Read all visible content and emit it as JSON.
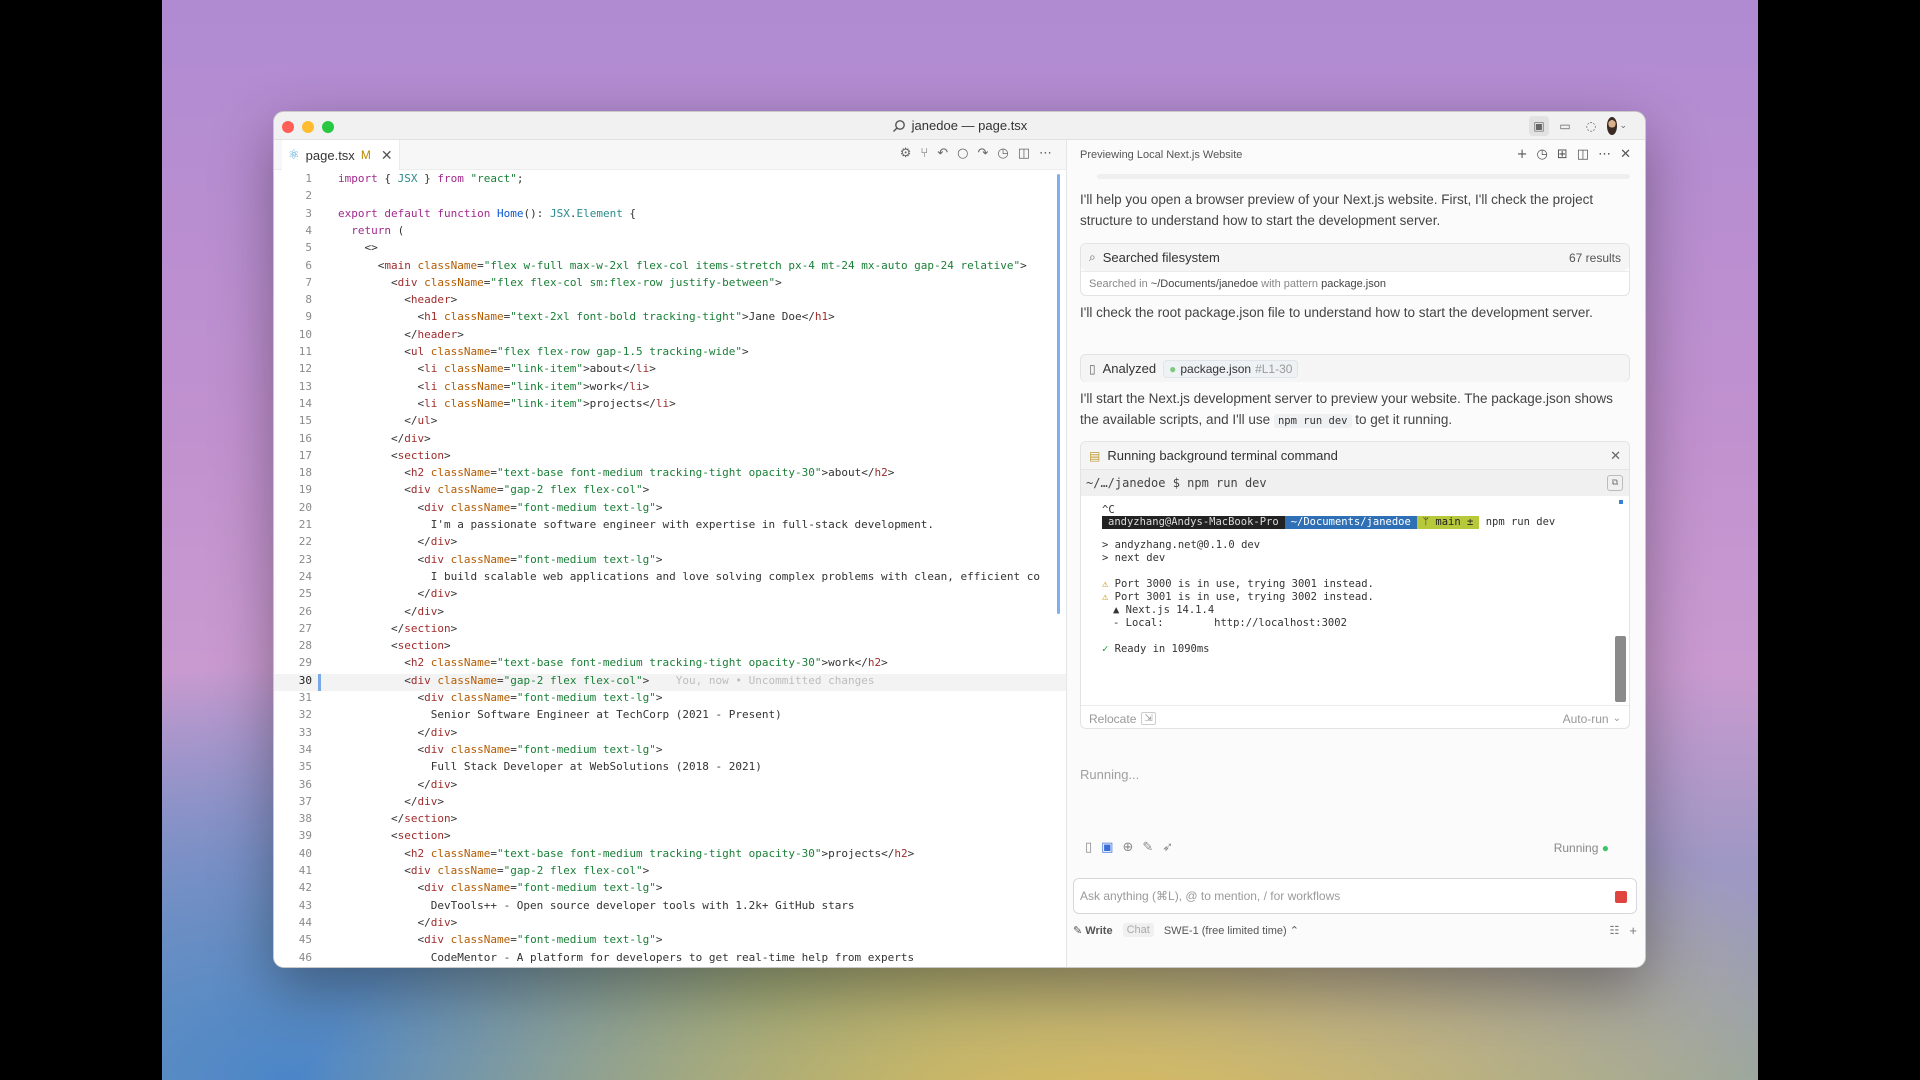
{
  "window": {
    "title": "janedoe — page.tsx",
    "traffic_lights": {
      "close": "#ff5f57",
      "minimize": "#febc2e",
      "zoom": "#28c840"
    }
  },
  "editor": {
    "tab": {
      "filename": "page.tsx",
      "status": "M"
    },
    "current_line": 30,
    "blame_text": "You, now • Uncommitted changes",
    "lines": [
      [
        [
          "kw",
          "import "
        ],
        [
          "pl",
          "{ "
        ],
        [
          "typ",
          "JSX"
        ],
        [
          "pl",
          " } "
        ],
        [
          "kw",
          "from "
        ],
        [
          "str",
          "\"react\""
        ],
        [
          "pl",
          ";"
        ]
      ],
      [],
      [
        [
          "kw",
          "export default function "
        ],
        [
          "kb",
          "Home"
        ],
        [
          "pl",
          "(): "
        ],
        [
          "typ",
          "JSX"
        ],
        [
          "pl",
          "."
        ],
        [
          "typ",
          "Element"
        ],
        [
          "pl",
          " {"
        ]
      ],
      [
        [
          "pl",
          "  "
        ],
        [
          "kw",
          "return"
        ],
        [
          "pl",
          " ("
        ]
      ],
      [
        [
          "pl",
          "    <>"
        ]
      ],
      [
        [
          "pl",
          "      <"
        ],
        [
          "tag",
          "main "
        ],
        [
          "at",
          "className"
        ],
        [
          "pl",
          "="
        ],
        [
          "str",
          "\"flex w-full max-w-2xl flex-col items-stretch px-4 mt-24 mx-auto gap-24 relative\""
        ],
        [
          "pl",
          ">"
        ]
      ],
      [
        [
          "pl",
          "        <"
        ],
        [
          "tag",
          "div "
        ],
        [
          "at",
          "className"
        ],
        [
          "pl",
          "="
        ],
        [
          "str",
          "\"flex flex-col sm:flex-row justify-between\""
        ],
        [
          "pl",
          ">"
        ]
      ],
      [
        [
          "pl",
          "          <"
        ],
        [
          "tag",
          "header"
        ],
        [
          "pl",
          ">"
        ]
      ],
      [
        [
          "pl",
          "            <"
        ],
        [
          "tag",
          "h1 "
        ],
        [
          "at",
          "className"
        ],
        [
          "pl",
          "="
        ],
        [
          "str",
          "\"text-2xl font-bold tracking-tight\""
        ],
        [
          "pl",
          ">Jane Doe</"
        ],
        [
          "tag",
          "h1"
        ],
        [
          "pl",
          ">"
        ]
      ],
      [
        [
          "pl",
          "          </"
        ],
        [
          "tag",
          "header"
        ],
        [
          "pl",
          ">"
        ]
      ],
      [
        [
          "pl",
          "          <"
        ],
        [
          "tag",
          "ul "
        ],
        [
          "at",
          "className"
        ],
        [
          "pl",
          "="
        ],
        [
          "str",
          "\"flex flex-row gap-1.5 tracking-wide\""
        ],
        [
          "pl",
          ">"
        ]
      ],
      [
        [
          "pl",
          "            <"
        ],
        [
          "tag",
          "li "
        ],
        [
          "at",
          "className"
        ],
        [
          "pl",
          "="
        ],
        [
          "str",
          "\"link-item\""
        ],
        [
          "pl",
          ">about</"
        ],
        [
          "tag",
          "li"
        ],
        [
          "pl",
          ">"
        ]
      ],
      [
        [
          "pl",
          "            <"
        ],
        [
          "tag",
          "li "
        ],
        [
          "at",
          "className"
        ],
        [
          "pl",
          "="
        ],
        [
          "str",
          "\"link-item\""
        ],
        [
          "pl",
          ">work</"
        ],
        [
          "tag",
          "li"
        ],
        [
          "pl",
          ">"
        ]
      ],
      [
        [
          "pl",
          "            <"
        ],
        [
          "tag",
          "li "
        ],
        [
          "at",
          "className"
        ],
        [
          "pl",
          "="
        ],
        [
          "str",
          "\"link-item\""
        ],
        [
          "pl",
          ">projects</"
        ],
        [
          "tag",
          "li"
        ],
        [
          "pl",
          ">"
        ]
      ],
      [
        [
          "pl",
          "          </"
        ],
        [
          "tag",
          "ul"
        ],
        [
          "pl",
          ">"
        ]
      ],
      [
        [
          "pl",
          "        </"
        ],
        [
          "tag",
          "div"
        ],
        [
          "pl",
          ">"
        ]
      ],
      [
        [
          "pl",
          "        <"
        ],
        [
          "tag",
          "section"
        ],
        [
          "pl",
          ">"
        ]
      ],
      [
        [
          "pl",
          "          <"
        ],
        [
          "tag",
          "h2 "
        ],
        [
          "at",
          "className"
        ],
        [
          "pl",
          "="
        ],
        [
          "str",
          "\"text-base font-medium tracking-tight opacity-30\""
        ],
        [
          "pl",
          ">about</"
        ],
        [
          "tag",
          "h2"
        ],
        [
          "pl",
          ">"
        ]
      ],
      [
        [
          "pl",
          "          <"
        ],
        [
          "tag",
          "div "
        ],
        [
          "at",
          "className"
        ],
        [
          "pl",
          "="
        ],
        [
          "str",
          "\"gap-2 flex flex-col\""
        ],
        [
          "pl",
          ">"
        ]
      ],
      [
        [
          "pl",
          "            <"
        ],
        [
          "tag",
          "div "
        ],
        [
          "at",
          "className"
        ],
        [
          "pl",
          "="
        ],
        [
          "str",
          "\"font-medium text-lg\""
        ],
        [
          "pl",
          ">"
        ]
      ],
      [
        [
          "pl",
          "              I'm a passionate software engineer with expertise in full-stack development."
        ]
      ],
      [
        [
          "pl",
          "            </"
        ],
        [
          "tag",
          "div"
        ],
        [
          "pl",
          ">"
        ]
      ],
      [
        [
          "pl",
          "            <"
        ],
        [
          "tag",
          "div "
        ],
        [
          "at",
          "className"
        ],
        [
          "pl",
          "="
        ],
        [
          "str",
          "\"font-medium text-lg\""
        ],
        [
          "pl",
          ">"
        ]
      ],
      [
        [
          "pl",
          "              I build scalable web applications and love solving complex problems with clean, efficient co"
        ]
      ],
      [
        [
          "pl",
          "            </"
        ],
        [
          "tag",
          "div"
        ],
        [
          "pl",
          ">"
        ]
      ],
      [
        [
          "pl",
          "          </"
        ],
        [
          "tag",
          "div"
        ],
        [
          "pl",
          ">"
        ]
      ],
      [
        [
          "pl",
          "        </"
        ],
        [
          "tag",
          "section"
        ],
        [
          "pl",
          ">"
        ]
      ],
      [
        [
          "pl",
          "        <"
        ],
        [
          "tag",
          "section"
        ],
        [
          "pl",
          ">"
        ]
      ],
      [
        [
          "pl",
          "          <"
        ],
        [
          "tag",
          "h2 "
        ],
        [
          "at",
          "className"
        ],
        [
          "pl",
          "="
        ],
        [
          "str",
          "\"text-base font-medium tracking-tight opacity-30\""
        ],
        [
          "pl",
          ">work</"
        ],
        [
          "tag",
          "h2"
        ],
        [
          "pl",
          ">"
        ]
      ],
      [
        [
          "pl",
          "          <"
        ],
        [
          "tag",
          "div "
        ],
        [
          "at",
          "className"
        ],
        [
          "pl",
          "="
        ],
        [
          "str",
          "\"gap-2 flex flex-col\""
        ],
        [
          "pl",
          ">"
        ]
      ],
      [
        [
          "pl",
          "            <"
        ],
        [
          "tag",
          "div "
        ],
        [
          "at",
          "className"
        ],
        [
          "pl",
          "="
        ],
        [
          "str",
          "\"font-medium text-lg\""
        ],
        [
          "pl",
          ">"
        ]
      ],
      [
        [
          "pl",
          "              Senior Software Engineer at TechCorp (2021 - Present)"
        ]
      ],
      [
        [
          "pl",
          "            </"
        ],
        [
          "tag",
          "div"
        ],
        [
          "pl",
          ">"
        ]
      ],
      [
        [
          "pl",
          "            <"
        ],
        [
          "tag",
          "div "
        ],
        [
          "at",
          "className"
        ],
        [
          "pl",
          "="
        ],
        [
          "str",
          "\"font-medium text-lg\""
        ],
        [
          "pl",
          ">"
        ]
      ],
      [
        [
          "pl",
          "              Full Stack Developer at WebSolutions (2018 - 2021)"
        ]
      ],
      [
        [
          "pl",
          "            </"
        ],
        [
          "tag",
          "div"
        ],
        [
          "pl",
          ">"
        ]
      ],
      [
        [
          "pl",
          "          </"
        ],
        [
          "tag",
          "div"
        ],
        [
          "pl",
          ">"
        ]
      ],
      [
        [
          "pl",
          "        </"
        ],
        [
          "tag",
          "section"
        ],
        [
          "pl",
          ">"
        ]
      ],
      [
        [
          "pl",
          "        <"
        ],
        [
          "tag",
          "section"
        ],
        [
          "pl",
          ">"
        ]
      ],
      [
        [
          "pl",
          "          <"
        ],
        [
          "tag",
          "h2 "
        ],
        [
          "at",
          "className"
        ],
        [
          "pl",
          "="
        ],
        [
          "str",
          "\"text-base font-medium tracking-tight opacity-30\""
        ],
        [
          "pl",
          ">projects</"
        ],
        [
          "tag",
          "h2"
        ],
        [
          "pl",
          ">"
        ]
      ],
      [
        [
          "pl",
          "          <"
        ],
        [
          "tag",
          "div "
        ],
        [
          "at",
          "className"
        ],
        [
          "pl",
          "="
        ],
        [
          "str",
          "\"gap-2 flex flex-col\""
        ],
        [
          "pl",
          ">"
        ]
      ],
      [
        [
          "pl",
          "            <"
        ],
        [
          "tag",
          "div "
        ],
        [
          "at",
          "className"
        ],
        [
          "pl",
          "="
        ],
        [
          "str",
          "\"font-medium text-lg\""
        ],
        [
          "pl",
          ">"
        ]
      ],
      [
        [
          "pl",
          "              DevTools++ - Open source developer tools with 1.2k+ GitHub stars"
        ]
      ],
      [
        [
          "pl",
          "            </"
        ],
        [
          "tag",
          "div"
        ],
        [
          "pl",
          ">"
        ]
      ],
      [
        [
          "pl",
          "            <"
        ],
        [
          "tag",
          "div "
        ],
        [
          "at",
          "className"
        ],
        [
          "pl",
          "="
        ],
        [
          "str",
          "\"font-medium text-lg\""
        ],
        [
          "pl",
          ">"
        ]
      ],
      [
        [
          "pl",
          "              CodeMentor - A platform for developers to get real-time help from experts"
        ]
      ]
    ]
  },
  "panel": {
    "title": "Previewing Local Next.js Website",
    "msg1": "I'll help you open a browser preview of your Next.js website. First, I'll check the project structure to understand how to start the development server.",
    "search": {
      "label": "Searched filesystem",
      "count": "67 results",
      "sub_prefix": "Searched in",
      "path": "~/Documents/janedoe",
      "sub_mid": "with pattern",
      "pattern": "package.json"
    },
    "msg2": "I'll check the root package.json file to understand how to start the development server.",
    "analyzed": {
      "label": "Analyzed",
      "file": "package.json",
      "range": "#L1-30"
    },
    "msg3a": "I'll start the Next.js development server to preview your website. The package.json shows the available scripts, and I'll use",
    "msg3_code": "npm run dev",
    "msg3b": "to get it running.",
    "terminal": {
      "title": "Running background terminal command",
      "command": "~/…/janedoe $ npm run dev",
      "ctrl_c": "^C",
      "prompt_user": "andyzhang@Andys-MacBook-Pro",
      "prompt_dir": "~/Documents/janedoe",
      "prompt_branch": "ᛘ main ±",
      "prompt_cmd": "npm run dev",
      "out1": "> andyzhang.net@0.1.0 dev",
      "out2": "> next dev",
      "warn1": "Port 3000 is in use, trying 3001 instead.",
      "warn2": "Port 3001 is in use, trying 3002 instead.",
      "next": "▲ Next.js 14.1.4",
      "local": "- Local:        http://localhost:3002",
      "ready": "Ready in 1090ms",
      "relocate": "Relocate",
      "autorun": "Auto-run"
    },
    "running_text": "Running...",
    "status": "Running",
    "input_placeholder": "Ask anything (⌘L), @ to mention, / for workflows",
    "mode_write": "Write",
    "mode_chat": "Chat",
    "model": "SWE-1 (free limited time)"
  }
}
